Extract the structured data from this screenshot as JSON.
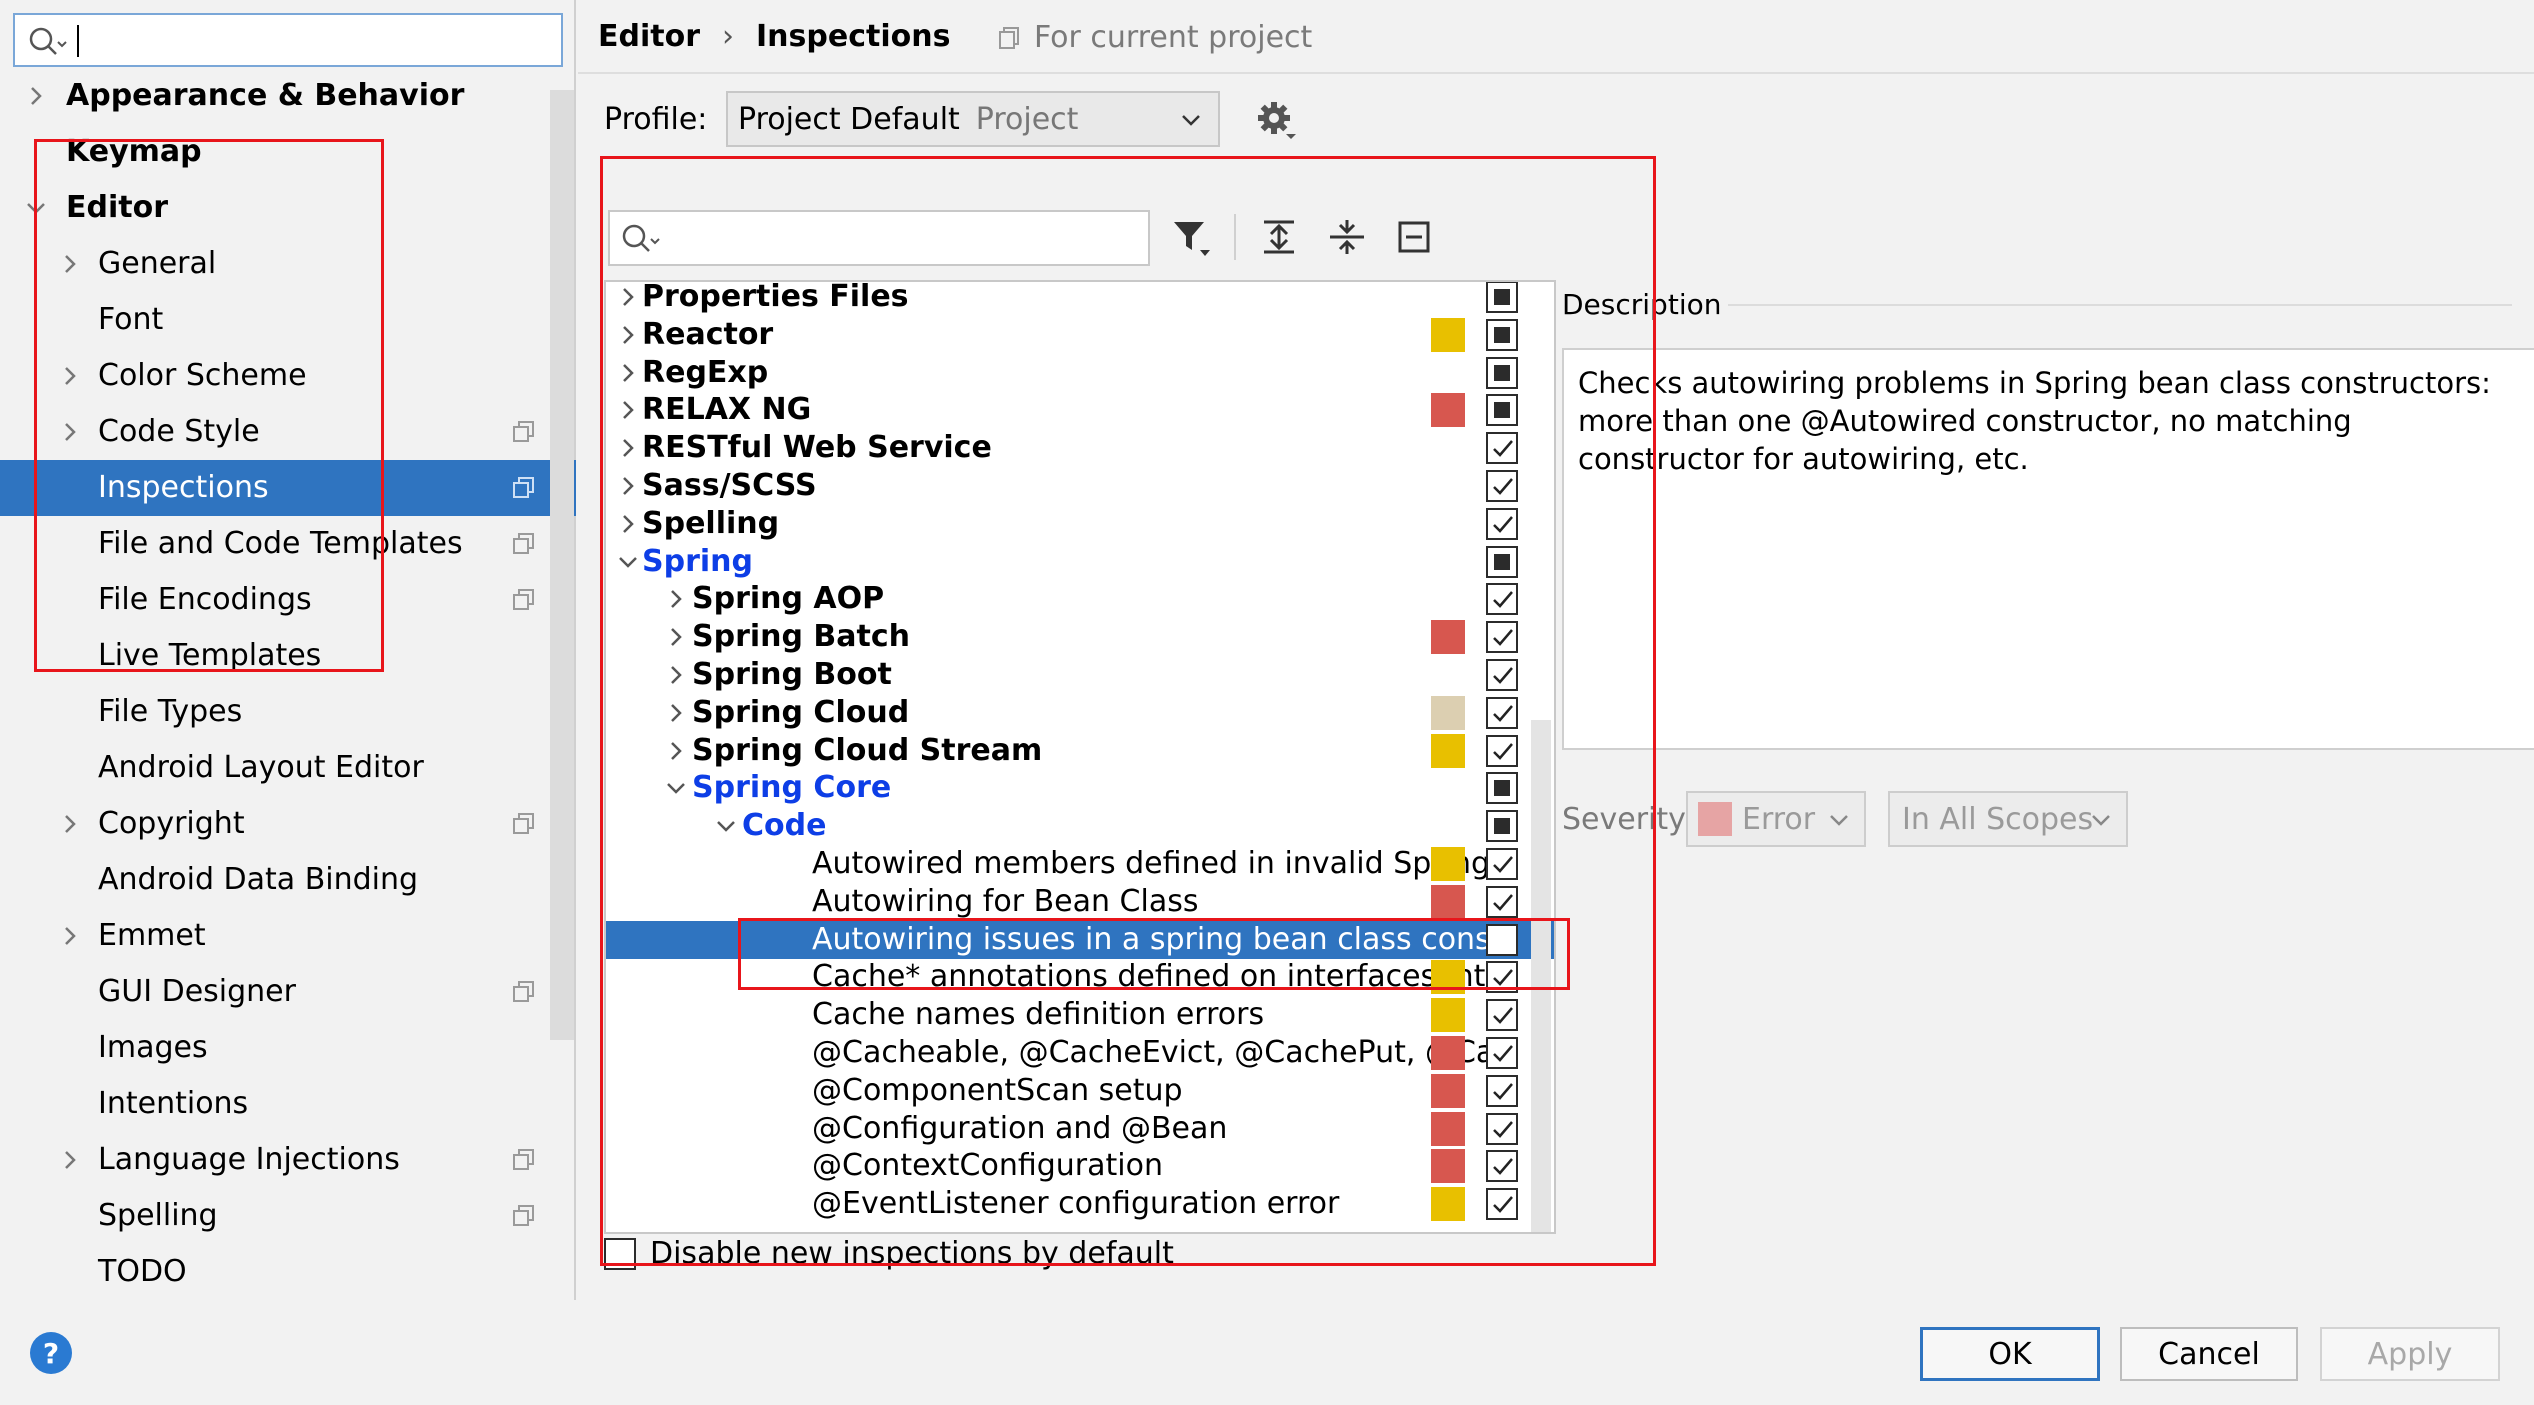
{
  "colors": {
    "selection": "#2f74c0",
    "spring_blue": "#0d3ee6",
    "sev_yellow": "#e8c000",
    "sev_red": "#d7574f",
    "sev_beige": "#dccfb1",
    "annotation_red": "#e8151b"
  },
  "sidebar": {
    "search_value": "",
    "items": [
      {
        "label": "Appearance & Behavior",
        "bold": true,
        "arrow": "right"
      },
      {
        "label": "Keymap",
        "bold": true,
        "arrow": ""
      },
      {
        "label": "Editor",
        "bold": true,
        "arrow": "down"
      },
      {
        "label": "General",
        "arrow": "right"
      },
      {
        "label": "Font",
        "arrow": ""
      },
      {
        "label": "Color Scheme",
        "arrow": "right"
      },
      {
        "label": "Code Style",
        "arrow": "right",
        "project_icon": true
      },
      {
        "label": "Inspections",
        "arrow": "",
        "project_icon": true,
        "selected": true
      },
      {
        "label": "File and Code Templates",
        "arrow": "",
        "project_icon": true
      },
      {
        "label": "File Encodings",
        "arrow": "",
        "project_icon": true
      },
      {
        "label": "Live Templates",
        "arrow": ""
      },
      {
        "label": "File Types",
        "arrow": ""
      },
      {
        "label": "Android Layout Editor",
        "arrow": ""
      },
      {
        "label": "Copyright",
        "arrow": "right",
        "project_icon": true
      },
      {
        "label": "Android Data Binding",
        "arrow": ""
      },
      {
        "label": "Emmet",
        "arrow": "right"
      },
      {
        "label": "GUI Designer",
        "arrow": "",
        "project_icon": true
      },
      {
        "label": "Images",
        "arrow": ""
      },
      {
        "label": "Intentions",
        "arrow": ""
      },
      {
        "label": "Language Injections",
        "arrow": "right",
        "project_icon": true
      },
      {
        "label": "Spelling",
        "arrow": "",
        "project_icon": true
      },
      {
        "label": "TODO",
        "arrow": ""
      }
    ],
    "help_label": "?"
  },
  "header": {
    "crumb_editor": "Editor",
    "crumb_sep": "›",
    "crumb_inspections": "Inspections",
    "for_current_project": "For current project"
  },
  "profile": {
    "label": "Profile:",
    "value": "Project Default",
    "scope": "Project"
  },
  "inspections": {
    "search_value": "",
    "rows": [
      {
        "label": "Properties Files",
        "level": 0,
        "arrow": "right",
        "type": "cat",
        "severity": "",
        "check": "mixed"
      },
      {
        "label": "Reactor",
        "level": 0,
        "arrow": "right",
        "type": "cat",
        "severity": "yellow",
        "check": "mixed"
      },
      {
        "label": "RegExp",
        "level": 0,
        "arrow": "right",
        "type": "cat",
        "severity": "",
        "check": "mixed"
      },
      {
        "label": "RELAX NG",
        "level": 0,
        "arrow": "right",
        "type": "cat",
        "severity": "red",
        "check": "mixed"
      },
      {
        "label": "RESTful Web Service",
        "level": 0,
        "arrow": "right",
        "type": "cat",
        "severity": "",
        "check": "checked"
      },
      {
        "label": "Sass/SCSS",
        "level": 0,
        "arrow": "right",
        "type": "cat",
        "severity": "",
        "check": "checked"
      },
      {
        "label": "Spelling",
        "level": 0,
        "arrow": "right",
        "type": "cat",
        "severity": "",
        "check": "checked"
      },
      {
        "label": "Spring",
        "level": 0,
        "arrow": "down",
        "type": "blue",
        "severity": "",
        "check": "mixed"
      },
      {
        "label": "Spring AOP",
        "level": 1,
        "arrow": "right",
        "type": "cat",
        "severity": "",
        "check": "checked"
      },
      {
        "label": "Spring Batch",
        "level": 1,
        "arrow": "right",
        "type": "cat",
        "severity": "red",
        "check": "checked"
      },
      {
        "label": "Spring Boot",
        "level": 1,
        "arrow": "right",
        "type": "cat",
        "severity": "",
        "check": "checked"
      },
      {
        "label": "Spring Cloud",
        "level": 1,
        "arrow": "right",
        "type": "cat",
        "severity": "beige",
        "check": "checked"
      },
      {
        "label": "Spring Cloud Stream",
        "level": 1,
        "arrow": "right",
        "type": "cat",
        "severity": "yellow",
        "check": "checked"
      },
      {
        "label": "Spring Core",
        "level": 1,
        "arrow": "down",
        "type": "blue",
        "severity": "",
        "check": "mixed"
      },
      {
        "label": "Code",
        "level": 2,
        "arrow": "down",
        "type": "blue",
        "severity": "",
        "check": "mixed"
      },
      {
        "label": "Autowired members defined in invalid Spring",
        "level": 3,
        "arrow": "",
        "type": "item",
        "severity": "yellow",
        "check": "checked"
      },
      {
        "label": "Autowiring for Bean Class",
        "level": 3,
        "arrow": "",
        "type": "item",
        "severity": "red",
        "check": "checked"
      },
      {
        "label": "Autowiring issues in a spring bean class constı",
        "level": 3,
        "arrow": "",
        "type": "item",
        "severity": "",
        "check": "unchecked",
        "selected": true
      },
      {
        "label": "Cache* annotations defined on interfaces/inte",
        "level": 3,
        "arrow": "",
        "type": "item",
        "severity": "yellow",
        "check": "checked"
      },
      {
        "label": "Cache names definition errors",
        "level": 3,
        "arrow": "",
        "type": "item",
        "severity": "yellow",
        "check": "checked"
      },
      {
        "label": "@Cacheable, @CacheEvict, @CachePut, @Cac",
        "level": 3,
        "arrow": "",
        "type": "item",
        "severity": "red",
        "check": "checked"
      },
      {
        "label": "@ComponentScan setup",
        "level": 3,
        "arrow": "",
        "type": "item",
        "severity": "red",
        "check": "checked"
      },
      {
        "label": "@Configuration and @Bean",
        "level": 3,
        "arrow": "",
        "type": "item",
        "severity": "red",
        "check": "checked"
      },
      {
        "label": "@ContextConfiguration",
        "level": 3,
        "arrow": "",
        "type": "item",
        "severity": "red",
        "check": "checked"
      },
      {
        "label": "@EventListener configuration error",
        "level": 3,
        "arrow": "",
        "type": "item",
        "severity": "yellow",
        "check": "checked"
      }
    ],
    "disable_new_label": "Disable new inspections by default"
  },
  "description": {
    "title": "Description",
    "text": "Checks autowiring problems in Spring bean class constructors: more than one @Autowired constructor, no matching constructor for autowiring, etc."
  },
  "severity": {
    "label": "Severity:",
    "value": "Error",
    "scope": "In All Scopes"
  },
  "buttons": {
    "ok": "OK",
    "cancel": "Cancel",
    "apply": "Apply"
  }
}
